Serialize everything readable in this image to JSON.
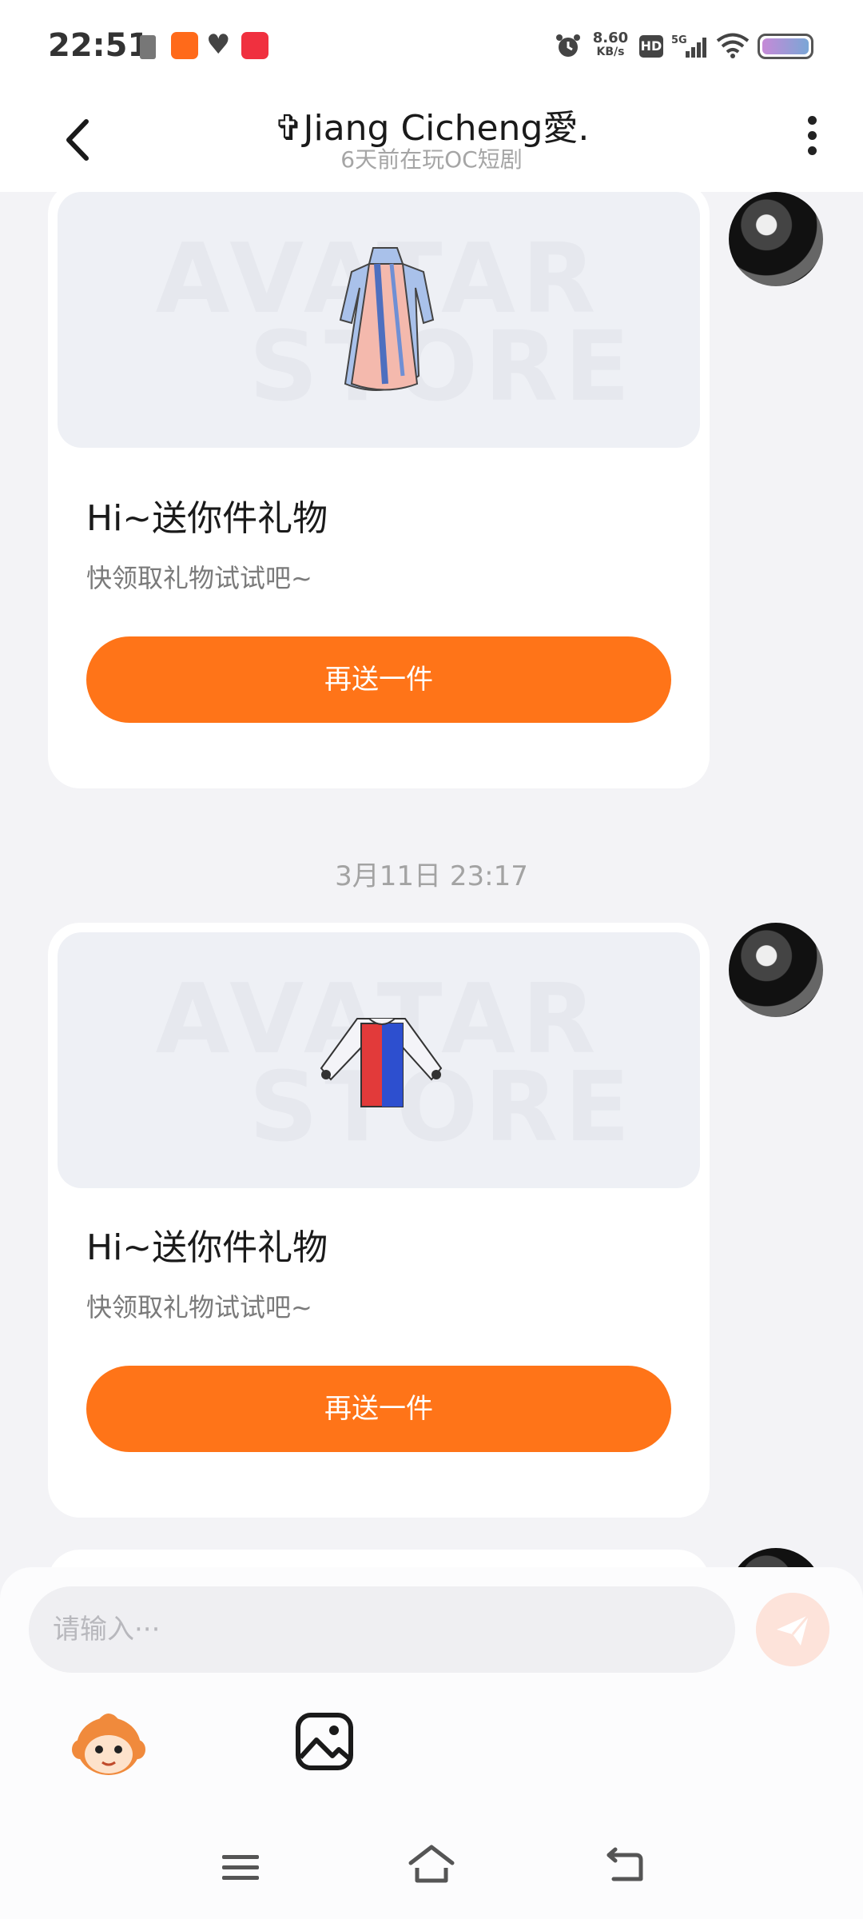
{
  "status_bar": {
    "time": "22:51",
    "net_speed_value": "8.60",
    "net_speed_unit": "KB/s",
    "hd_label": "HD",
    "network_label": "5G",
    "icons": [
      "battery-small-icon",
      "app-notification-icon",
      "heart-icon",
      "app-notification-icon",
      "alarm-icon",
      "signal-icon",
      "wifi-icon",
      "battery-icon"
    ]
  },
  "header": {
    "title": "✞Jiang Cicheng愛.",
    "subtitle": "6天前在玩OC短剧"
  },
  "messages": [
    {
      "title": "Hi~送你件礼物",
      "subtitle": "快领取礼物试试吧~",
      "button": "再送一件",
      "watermark_1": "AVATAR",
      "watermark_2": "STORE",
      "item_icon": "dress-icon"
    },
    {
      "timestamp": "3月11日 23:17",
      "title": "Hi~送你件礼物",
      "subtitle": "快领取礼物试试吧~",
      "button": "再送一件",
      "watermark_1": "AVATAR",
      "watermark_2": "STORE",
      "item_icon": "shirt-icon"
    }
  ],
  "input": {
    "placeholder": "请输入···"
  },
  "colors": {
    "accent": "#ff7418",
    "background": "#f3f3f6",
    "card": "#ffffff"
  }
}
